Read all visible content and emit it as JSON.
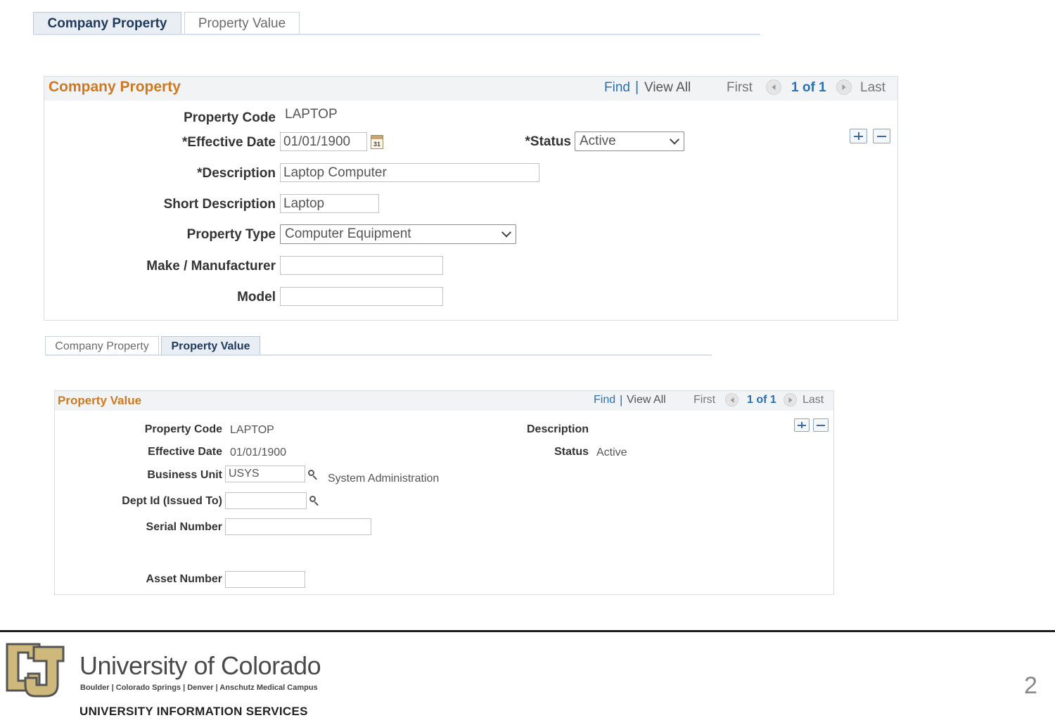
{
  "top_tabs": {
    "company_property": "Company Property",
    "property_value": "Property Value"
  },
  "company_property": {
    "title": "Company Property",
    "nav": {
      "find": "Find",
      "sep": "|",
      "view_all": "View All",
      "first": "First",
      "counter": "1 of 1",
      "last": "Last"
    },
    "labels": {
      "property_code": "Property Code",
      "effective_date": "*Effective Date",
      "status": "*Status",
      "description": "*Description",
      "short_description": "Short Description",
      "property_type": "Property Type",
      "make": "Make / Manufacturer",
      "model": "Model"
    },
    "values": {
      "property_code": "LAPTOP",
      "effective_date": "01/01/1900",
      "calendar_day": "31",
      "status": "Active",
      "description": "Laptop Computer",
      "short_description": "Laptop",
      "property_type": "Computer Equipment",
      "make": "",
      "model": ""
    }
  },
  "inner_tabs": {
    "company_property": "Company Property",
    "property_value": "Property Value"
  },
  "property_value": {
    "title": "Property Value",
    "nav": {
      "find": "Find",
      "sep": "|",
      "view_all": "View All",
      "first": "First",
      "counter": "1 of 1",
      "last": "Last"
    },
    "labels": {
      "property_code": "Property Code",
      "effective_date": "Effective Date",
      "business_unit": "Business Unit",
      "dept_id": "Dept Id (Issued To)",
      "serial_number": "Serial Number",
      "asset_number": "Asset Number",
      "description": "Description",
      "status": "Status"
    },
    "values": {
      "property_code": "LAPTOP",
      "effective_date": "01/01/1900",
      "business_unit": "USYS",
      "business_unit_desc": "System Administration",
      "dept_id": "",
      "serial_number": "",
      "asset_number": "",
      "status": "Active"
    }
  },
  "footer": {
    "university": "University of Colorado",
    "campuses": "Boulder | Colorado Springs | Denver | Anschutz Medical Campus",
    "department": "UNIVERSITY INFORMATION SERVICES",
    "page_number": "2",
    "logo_text": "CU"
  }
}
